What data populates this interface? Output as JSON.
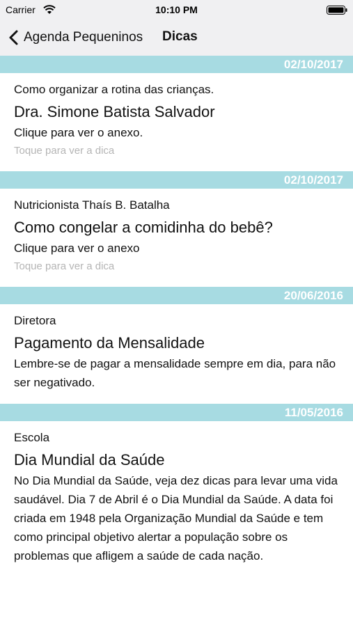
{
  "status_bar": {
    "carrier": "Carrier",
    "time": "10:10 PM",
    "wifi_icon": "wifi-icon",
    "battery_icon": "battery-icon"
  },
  "nav": {
    "back_label": "Agenda Pequeninos",
    "title": "Dicas",
    "back_icon": "chevron-left-icon"
  },
  "colors": {
    "date_header_bg": "#a7dbe2",
    "date_header_text": "#ffffff",
    "hint_text": "#b5b5b5"
  },
  "items": [
    {
      "date": "02/10/2017",
      "author": "Como organizar a rotina das crianças.",
      "title": "Dra. Simone Batista Salvador",
      "body": "Clique para ver o anexo.",
      "hint": "Toque para ver a dica"
    },
    {
      "date": "02/10/2017",
      "author": "Nutricionista Thaís B. Batalha",
      "title": "Como congelar a comidinha do bebê?",
      "body": "Clique para ver o anexo",
      "hint": "Toque para ver a dica"
    },
    {
      "date": "20/06/2016",
      "author": "Diretora",
      "title": "Pagamento da Mensalidade",
      "body": "Lembre-se de pagar a mensalidade sempre em dia, para não ser negativado."
    },
    {
      "date": "11/05/2016",
      "author": "Escola",
      "title": "Dia Mundial da Saúde",
      "body": "No Dia Mundial da Saúde, veja dez dicas para levar uma vida saudável. Dia 7 de Abril é o Dia Mundial da Saúde. A data foi criada em 1948 pela Organização Mundial da Saúde e tem como principal objetivo alertar a população sobre os problemas que afligem a saúde de cada nação."
    }
  ]
}
